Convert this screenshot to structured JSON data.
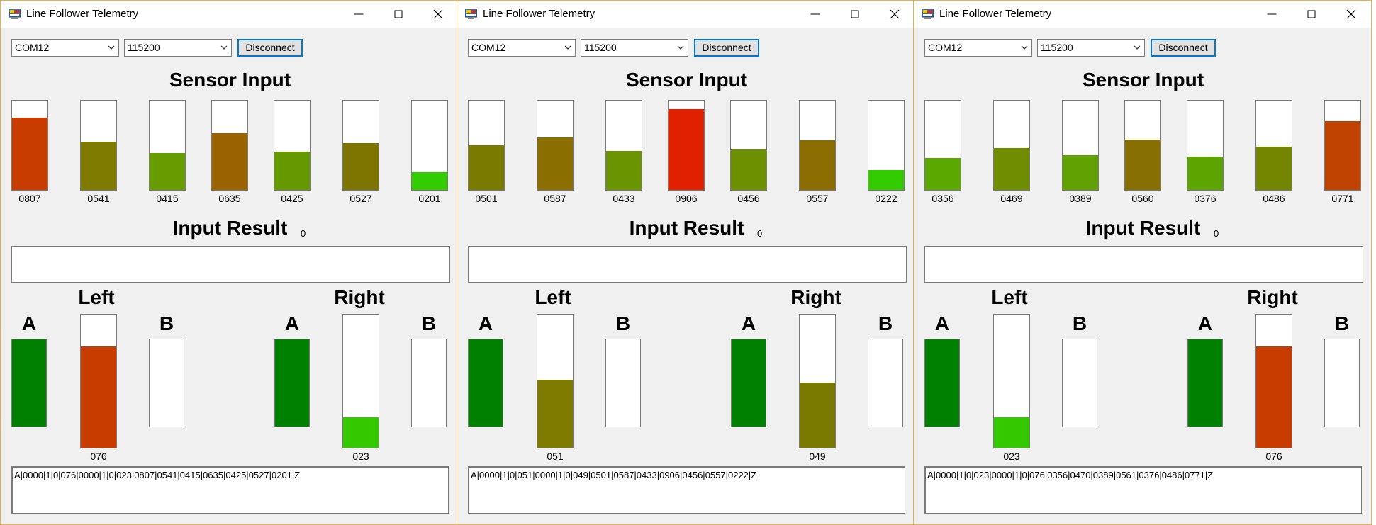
{
  "windows": [
    {
      "title": "Line Follower Telemetry",
      "port": "COM12",
      "baud": "115200",
      "button_label": "Disconnect",
      "sensor_heading": "Sensor Input",
      "sensors": [
        {
          "label": "0807",
          "level": 0.807,
          "color": "#c83c00"
        },
        {
          "label": "0541",
          "level": 0.541,
          "color": "#7f7a00"
        },
        {
          "label": "0415",
          "level": 0.415,
          "color": "#679c00"
        },
        {
          "label": "0635",
          "level": 0.635,
          "color": "#9a6300"
        },
        {
          "label": "0425",
          "level": 0.425,
          "color": "#649a00"
        },
        {
          "label": "0527",
          "level": 0.527,
          "color": "#7d7400"
        },
        {
          "label": "0201",
          "level": 0.201,
          "color": "#33cc00"
        }
      ],
      "result_heading": "Input Result",
      "result_value": "0",
      "left_title": "Left",
      "right_title": "Right",
      "left": {
        "a_label": "A",
        "b_label": "B",
        "a_on": true,
        "b_on": false,
        "power_label": "076",
        "power_level": 0.76,
        "power_color": "#c83c00"
      },
      "right": {
        "a_label": "A",
        "b_label": "B",
        "a_on": true,
        "b_on": false,
        "power_label": "023",
        "power_level": 0.23,
        "power_color": "#33c800"
      },
      "log": "A|0000|1|0|076|0000|1|0|023|0807|0541|0415|0635|0425|0527|0201|Z"
    },
    {
      "title": "Line Follower Telemetry",
      "port": "COM12",
      "baud": "115200",
      "button_label": "Disconnect",
      "sensor_heading": "Sensor Input",
      "sensors": [
        {
          "label": "0501",
          "level": 0.501,
          "color": "#7a7a00"
        },
        {
          "label": "0587",
          "level": 0.587,
          "color": "#8a6e00"
        },
        {
          "label": "0433",
          "level": 0.433,
          "color": "#6a9400"
        },
        {
          "label": "0906",
          "level": 0.906,
          "color": "#e02000"
        },
        {
          "label": "0456",
          "level": 0.456,
          "color": "#6c9000"
        },
        {
          "label": "0557",
          "level": 0.557,
          "color": "#8a6c00"
        },
        {
          "label": "0222",
          "level": 0.222,
          "color": "#33cc00"
        }
      ],
      "result_heading": "Input Result",
      "result_value": "0",
      "left_title": "Left",
      "right_title": "Right",
      "left": {
        "a_label": "A",
        "b_label": "B",
        "a_on": true,
        "b_on": false,
        "power_label": "051",
        "power_level": 0.51,
        "power_color": "#7f7a00"
      },
      "right": {
        "a_label": "A",
        "b_label": "B",
        "a_on": true,
        "b_on": false,
        "power_label": "049",
        "power_level": 0.49,
        "power_color": "#7a7a00"
      },
      "log": "A|0000|1|0|051|0000|1|0|049|0501|0587|0433|0906|0456|0557|0222|Z"
    },
    {
      "title": "Line Follower Telemetry",
      "port": "COM12",
      "baud": "115200",
      "button_label": "Disconnect",
      "sensor_heading": "Sensor Input",
      "sensors": [
        {
          "label": "0356",
          "level": 0.356,
          "color": "#5aa800"
        },
        {
          "label": "0469",
          "level": 0.469,
          "color": "#708c00"
        },
        {
          "label": "0389",
          "level": 0.389,
          "color": "#60a000"
        },
        {
          "label": "0560",
          "level": 0.56,
          "color": "#876e00"
        },
        {
          "label": "0376",
          "level": 0.376,
          "color": "#5ca400"
        },
        {
          "label": "0486",
          "level": 0.486,
          "color": "#748600"
        },
        {
          "label": "0771",
          "level": 0.771,
          "color": "#c04200"
        }
      ],
      "result_heading": "Input Result",
      "result_value": "0",
      "left_title": "Left",
      "right_title": "Right",
      "left": {
        "a_label": "A",
        "b_label": "B",
        "a_on": true,
        "b_on": false,
        "power_label": "023",
        "power_level": 0.23,
        "power_color": "#33c800"
      },
      "right": {
        "a_label": "A",
        "b_label": "B",
        "a_on": true,
        "b_on": false,
        "power_label": "076",
        "power_level": 0.76,
        "power_color": "#c83c00"
      },
      "log": "A|0000|1|0|023|0000|1|0|076|0356|0470|0389|0561|0376|0486|0771|Z"
    }
  ],
  "on_color": "#008000",
  "off_color": "#ffffff"
}
